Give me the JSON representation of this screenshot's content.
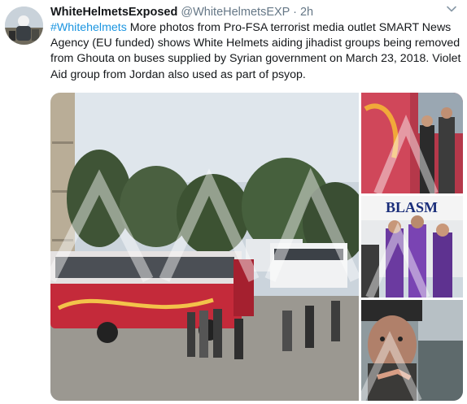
{
  "tweet": {
    "display_name": "WhiteHelmetsExposed",
    "handle": "@WhiteHelmetsEXP",
    "separator": "·",
    "timestamp": "2h",
    "hashtag": "#Whitehelmets",
    "body": " More photos from Pro-FSA terrorist media outlet SMART News Agency (EU funded) shows White Helmets aiding jihadist groups being removed from Ghouta on buses supplied by Syrian government on March 23, 2018. Violet Aid group from Jordan also used as part of psyop."
  },
  "media": {
    "bus_sign_text": "BLASM"
  },
  "icons": {
    "menu": "chevron-down-icon"
  },
  "colors": {
    "link": "#1b95e0",
    "secondary_text": "#657786",
    "primary_text": "#14171a"
  }
}
